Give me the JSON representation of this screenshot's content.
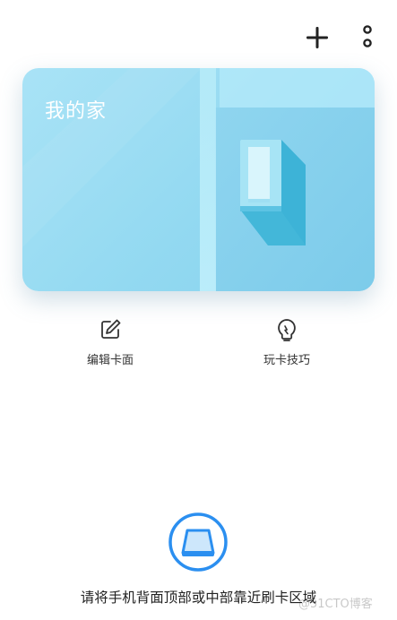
{
  "header": {
    "add_icon": "plus-icon",
    "more_icon": "more-vertical-icon"
  },
  "card": {
    "title": "我的家"
  },
  "actions": [
    {
      "label": "编辑卡面",
      "icon": "edit-icon"
    },
    {
      "label": "玩卡技巧",
      "icon": "lightbulb-icon"
    }
  ],
  "nfc": {
    "icon": "nfc-card-icon",
    "hint": "请将手机背面顶部或中部靠近刷卡区域"
  },
  "watermark": "@51CTO博客",
  "colors": {
    "card": "#93d9f1",
    "accent": "#2b8ff0"
  }
}
